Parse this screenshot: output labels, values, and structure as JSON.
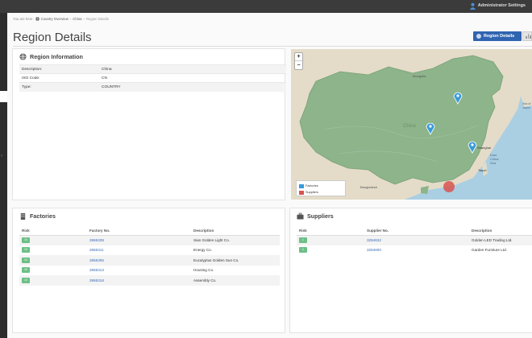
{
  "topbar": {
    "user_name": "Administrator Settings",
    "user_icon": "person-icon"
  },
  "breadcrumb": {
    "prefix": "You are here:",
    "items": [
      "Country Overview",
      "China",
      "Region Details"
    ]
  },
  "page": {
    "title": "Region Details"
  },
  "title_actions": {
    "region_button": "Region Details"
  },
  "region_info": {
    "heading": "Region Information",
    "rows": [
      {
        "label": "Description:",
        "value": "China"
      },
      {
        "label": "ISO Code:",
        "value": "CN"
      },
      {
        "label": "Type:",
        "value": "COUNTRY"
      }
    ]
  },
  "map": {
    "zoom_in": "+",
    "zoom_out": "−",
    "legend": [
      {
        "label": "Factories",
        "color": "#3a9ad9"
      },
      {
        "label": "Suppliers",
        "color": "#d9534f"
      }
    ],
    "labels": [
      "Mongolia",
      "China",
      "Shanghai",
      "Taipei",
      "Bangladesh",
      "East China Sea",
      "Sea of Japan"
    ]
  },
  "factories": {
    "heading": "Factories",
    "columns": [
      "Risk",
      "Factory No.",
      "Description"
    ],
    "rows": [
      {
        "risk": "10",
        "number": "2865339",
        "description": "Sian Golden Light Co."
      },
      {
        "risk": "10",
        "number": "2865311",
        "description": "Energy Co."
      },
      {
        "risk": "10",
        "number": "2865306",
        "description": "Eucalyptus Golden Sun Co."
      },
      {
        "risk": "10",
        "number": "2865313",
        "description": "Housing Co."
      },
      {
        "risk": "10",
        "number": "2865318",
        "description": "Assembly Co."
      }
    ]
  },
  "suppliers": {
    "heading": "Suppliers",
    "columns": [
      "Risk",
      "Supplier No.",
      "Description"
    ],
    "rows": [
      {
        "risk": "1",
        "number": "3284632",
        "description": "Golden LED Trading Ltd."
      },
      {
        "risk": "1",
        "number": "3284600",
        "description": "Garden Furniture Ltd."
      }
    ]
  },
  "colors": {
    "accent": "#2f64b0",
    "risk_ok": "#6dbf86",
    "link": "#3a6bb8",
    "topbar": "#3b3b3b"
  }
}
